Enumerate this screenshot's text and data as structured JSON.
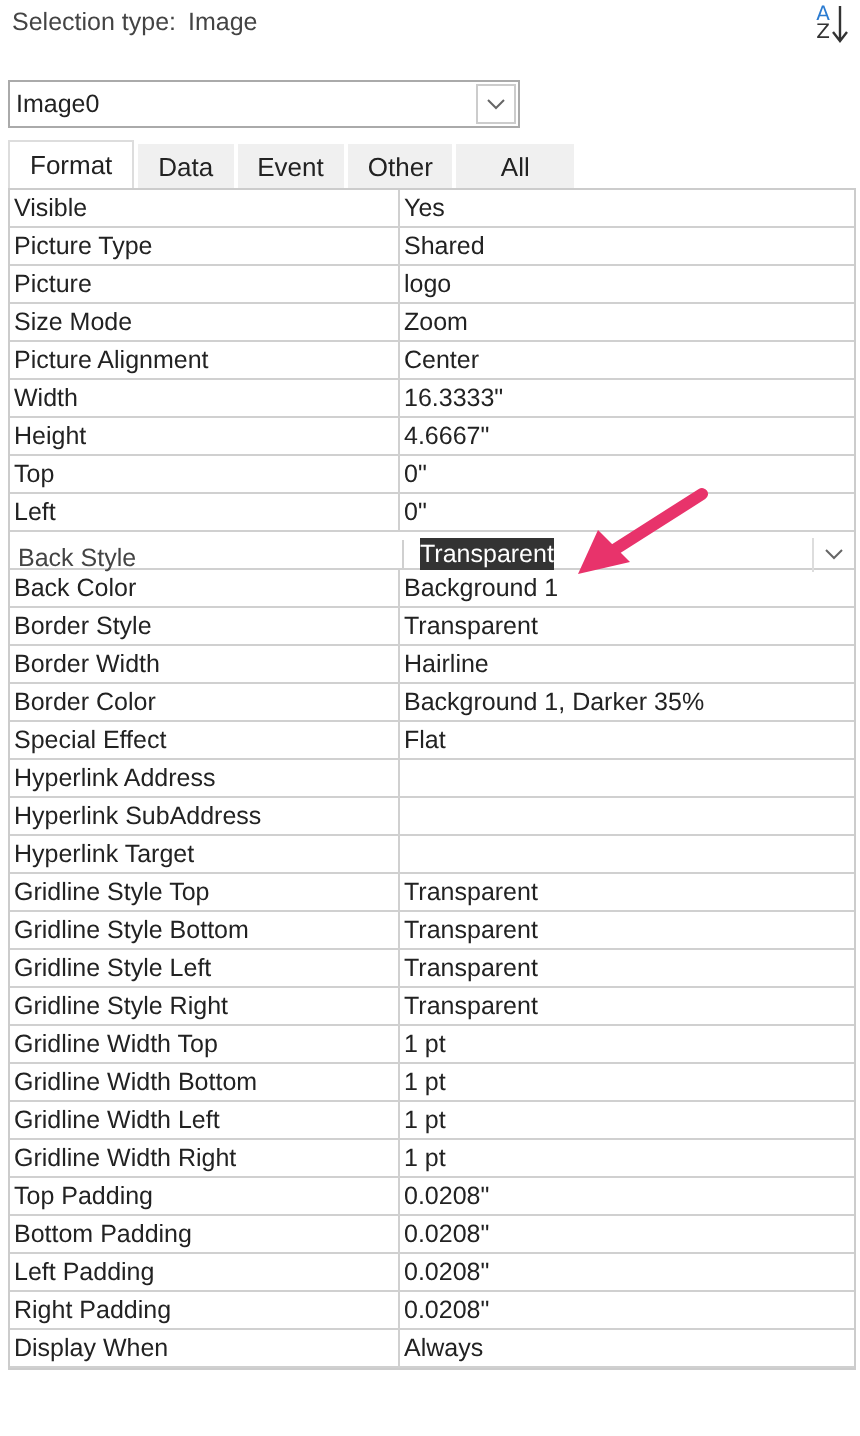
{
  "selection_type": {
    "label": "Selection type:",
    "value": "Image"
  },
  "sort_button": {
    "top": "A",
    "bottom": "Z"
  },
  "object_select": {
    "value": "Image0"
  },
  "tabs": [
    {
      "label": "Format",
      "selected": true
    },
    {
      "label": "Data",
      "selected": false
    },
    {
      "label": "Event",
      "selected": false
    },
    {
      "label": "Other",
      "selected": false
    },
    {
      "label": "All",
      "selected": false
    }
  ],
  "properties": [
    {
      "name": "Visible",
      "value": "Yes",
      "selected": false
    },
    {
      "name": "Picture Type",
      "value": "Shared",
      "selected": false
    },
    {
      "name": "Picture",
      "value": "logo",
      "selected": false
    },
    {
      "name": "Size Mode",
      "value": "Zoom",
      "selected": false
    },
    {
      "name": "Picture Alignment",
      "value": "Center",
      "selected": false
    },
    {
      "name": "Width",
      "value": "16.3333\"",
      "selected": false
    },
    {
      "name": "Height",
      "value": "4.6667\"",
      "selected": false
    },
    {
      "name": "Top",
      "value": "0\"",
      "selected": false
    },
    {
      "name": "Left",
      "value": "0\"",
      "selected": false
    },
    {
      "name": "Back Style",
      "value": "Transparent",
      "selected": true
    },
    {
      "name": "Back Color",
      "value": "Background 1",
      "selected": false
    },
    {
      "name": "Border Style",
      "value": "Transparent",
      "selected": false
    },
    {
      "name": "Border Width",
      "value": "Hairline",
      "selected": false
    },
    {
      "name": "Border Color",
      "value": "Background 1, Darker 35%",
      "selected": false
    },
    {
      "name": "Special Effect",
      "value": "Flat",
      "selected": false
    },
    {
      "name": "Hyperlink Address",
      "selected": false
    },
    {
      "name": "Hyperlink SubAddress",
      "selected": false
    },
    {
      "name": "Hyperlink Target",
      "selected": false
    },
    {
      "name": "Gridline Style Top",
      "value": "Transparent",
      "selected": false
    },
    {
      "name": "Gridline Style Bottom",
      "value": "Transparent",
      "selected": false
    },
    {
      "name": "Gridline Style Left",
      "value": "Transparent",
      "selected": false
    },
    {
      "name": "Gridline Style Right",
      "value": "Transparent",
      "selected": false
    },
    {
      "name": "Gridline Width Top",
      "value": "1 pt",
      "selected": false
    },
    {
      "name": "Gridline Width Bottom",
      "value": "1 pt",
      "selected": false
    },
    {
      "name": "Gridline Width Left",
      "value": "1 pt",
      "selected": false
    },
    {
      "name": "Gridline Width Right",
      "value": "1 pt",
      "selected": false
    },
    {
      "name": "Top Padding",
      "value": "0.0208\"",
      "selected": false
    },
    {
      "name": "Bottom Padding",
      "value": "0.0208\"",
      "selected": false
    },
    {
      "name": "Left Padding",
      "value": "0.0208\"",
      "selected": false
    },
    {
      "name": "Right Padding",
      "value": "0.0208\"",
      "selected": false
    },
    {
      "name": "Display When",
      "value": "Always",
      "selected": false
    }
  ]
}
